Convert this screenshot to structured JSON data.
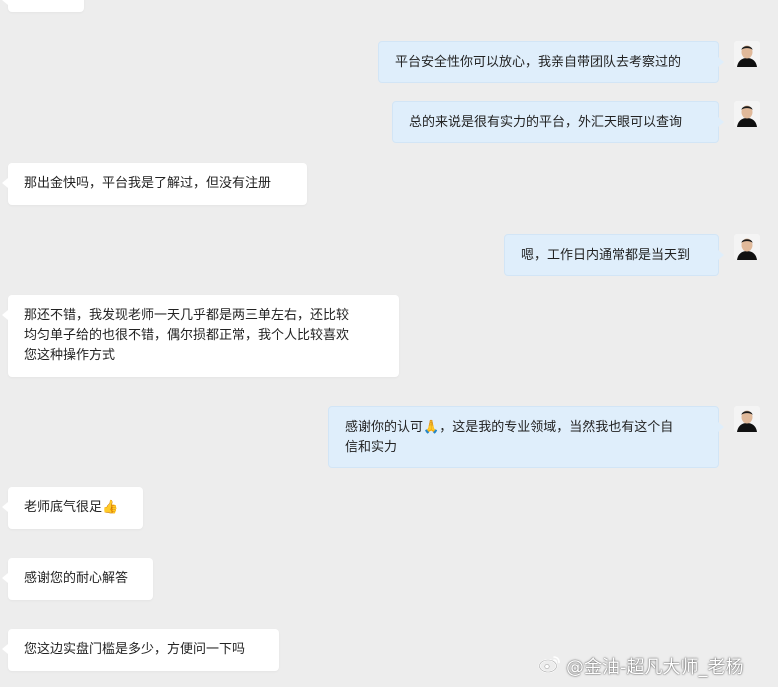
{
  "conversation": {
    "messages": [
      {
        "id": "m1",
        "side": "out",
        "text": "平台安全性你可以放心，我亲自带团队去考察过的"
      },
      {
        "id": "m2",
        "side": "out",
        "text": "总的来说是很有实力的平台，外汇天眼可以查询"
      },
      {
        "id": "m3",
        "side": "in",
        "text": "那出金快吗，平台我是了解过，但没有注册"
      },
      {
        "id": "m4",
        "side": "out",
        "text": "嗯，工作日内通常都是当天到"
      },
      {
        "id": "m5",
        "side": "in",
        "lines": [
          "那还不错，我发现老师一天几乎都是两三单左右，还比较",
          "均匀单子给的也很不错，偶尔损都正常，我个人比较喜欢",
          "您这种操作方式"
        ]
      },
      {
        "id": "m6",
        "side": "out",
        "line1_before": "感谢你的认可",
        "line1_emoji": "🙏",
        "line1_after": "，这是我的专业领域，当然我也有这个自",
        "line2": "信和实力"
      },
      {
        "id": "m7",
        "side": "in",
        "text": "老师底气很足",
        "emoji": "👍"
      },
      {
        "id": "m8",
        "side": "in",
        "text": "感谢您的耐心解答"
      },
      {
        "id": "m9",
        "side": "in",
        "text": "您这边实盘门槛是多少，方便问一下吗"
      }
    ],
    "avatar_icon": "user-avatar-icon"
  },
  "watermark": {
    "logo_icon": "weibo-logo-icon",
    "text": "@金油-超凡大师_老杨"
  },
  "colors": {
    "background": "#ededed",
    "incoming_bubble": "#ffffff",
    "outgoing_bubble": "#dfeefb"
  }
}
